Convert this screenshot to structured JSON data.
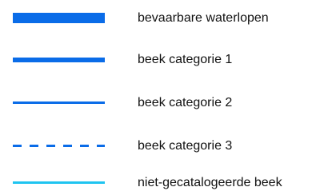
{
  "legend": {
    "items": [
      {
        "label": "bevaarbare waterlopen",
        "color": "#0a6ce8",
        "style": "thick-solid"
      },
      {
        "label": "beek categorie 1",
        "color": "#0a6ce8",
        "style": "medium-solid"
      },
      {
        "label": "beek categorie 2",
        "color": "#0a6ce8",
        "style": "thin-solid"
      },
      {
        "label": "beek categorie 3",
        "color": "#0a6ce8",
        "style": "thin-dashed"
      },
      {
        "label": "niet-gecatalogeerde beek",
        "color": "#1fc4f0",
        "style": "thin-solid"
      }
    ]
  }
}
